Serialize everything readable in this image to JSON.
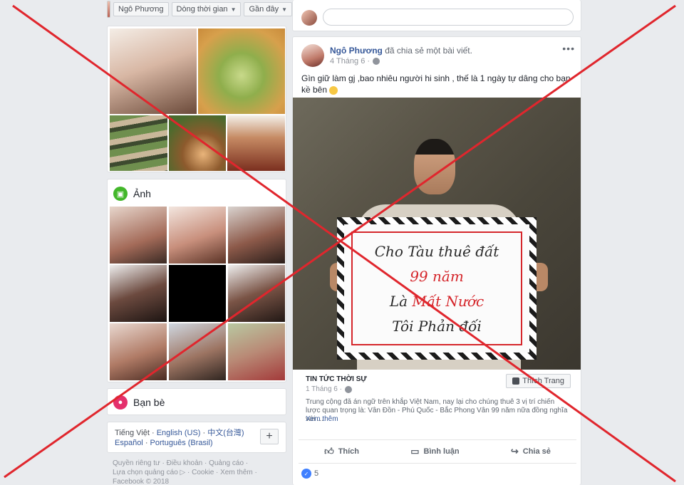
{
  "timeline_filter": {
    "name": "Ngô Phương",
    "timeline_label": "Dòng thời gian",
    "recent_label": "Gần đây"
  },
  "photos_section": {
    "title": "Ảnh"
  },
  "friends_section": {
    "title": "Bạn bè"
  },
  "languages": {
    "line1": [
      "Tiếng Việt",
      "English (US)",
      "中文(台灣)"
    ],
    "line2": [
      "Español",
      "Português (Brasil)"
    ],
    "add_label": "+"
  },
  "footer": {
    "line1": "Quyền riêng tư · Điều khoản · Quảng cáo ·",
    "line2": "Lựa chọn quảng cáo ▷ · Cookie · Xem thêm ·",
    "copyright": "Facebook © 2018"
  },
  "post": {
    "author": "Ngô Phương",
    "action": "đã chia sẻ một bài viết.",
    "date": "4 Tháng 6 ·",
    "text": "Gìn giữ làm gj ,bao nhiêu người hi sinh , thế là 1 ngày tự dâng cho bạn kề bên",
    "sign": {
      "line1": "Cho Tàu thuê đất",
      "line2": "99 năm",
      "line3_a": "Là",
      "line3_b": "Mất Nước",
      "line4": "Tôi Phản đối"
    },
    "shared": {
      "source": "TIN TỨC THỜI SỰ",
      "date": "1 Tháng 6 ·",
      "like_page": "Thích Trang",
      "description": "Trung cộng đã án ngữ trên khắp Việt Nam, nay lại cho chúng thuê 3 vị trí chiến lược quan trọng là: Vân Đồn - Phú Quốc - Bắc Phong Vân 99 năm nữa đồng nghĩa với ...",
      "see_more": "Xem thêm"
    },
    "actions": {
      "like": "Thích",
      "comment": "Bình luận",
      "share": "Chia sẻ"
    },
    "reaction_count": "5"
  },
  "colors": {
    "accent": "#365899",
    "cross": "#e0262d"
  }
}
